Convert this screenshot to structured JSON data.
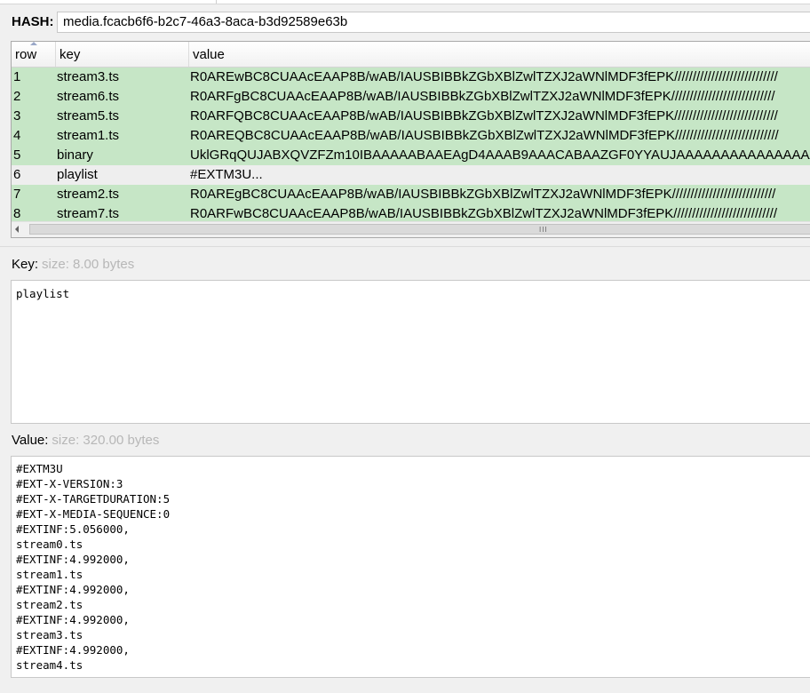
{
  "hash": {
    "label": "HASH:",
    "value": "media.fcacb6f6-b2c7-46a3-8aca-b3d92589e63b"
  },
  "table": {
    "columns": {
      "row": "row",
      "key": "key",
      "value": "value"
    },
    "rows": [
      {
        "row": "1",
        "key": "stream3.ts",
        "value": "R0AREwBC8CUAAcEAAP8B/wAB/IAUSBIBBkZGbXBlZwlTZXJ2aWNlMDF3fEPK////////////////////////////",
        "highlight": "green"
      },
      {
        "row": "2",
        "key": "stream6.ts",
        "value": "R0ARFgBC8CUAAcEAAP8B/wAB/IAUSBIBBkZGbXBlZwlTZXJ2aWNlMDF3fEPK////////////////////////////",
        "highlight": "green"
      },
      {
        "row": "3",
        "key": "stream5.ts",
        "value": "R0ARFQBC8CUAAcEAAP8B/wAB/IAUSBIBBkZGbXBlZwlTZXJ2aWNlMDF3fEPK////////////////////////////",
        "highlight": "green"
      },
      {
        "row": "4",
        "key": "stream1.ts",
        "value": "R0AREQBC8CUAAcEAAP8B/wAB/IAUSBIBBkZGbXBlZwlTZXJ2aWNlMDF3fEPK////////////////////////////",
        "highlight": "green"
      },
      {
        "row": "5",
        "key": "binary",
        "value": "UklGRqQUJABXQVZFZm10IBAAAAABAAEAgD4AAAB9AAACABAAZGF0YYAUJAAAAAAAAAAAAAAAA",
        "highlight": "green"
      },
      {
        "row": "6",
        "key": "playlist",
        "value": "#EXTM3U...",
        "highlight": "plain"
      },
      {
        "row": "7",
        "key": "stream2.ts",
        "value": "R0AREgBC8CUAAcEAAP8B/wAB/IAUSBIBBkZGbXBlZwlTZXJ2aWNlMDF3fEPK////////////////////////////",
        "highlight": "green"
      },
      {
        "row": "8",
        "key": "stream7.ts",
        "value": "R0ARFwBC8CUAAcEAAP8B/wAB/IAUSBIBBkZGbXBlZwlTZXJ2aWNlMDF3fEPK////////////////////////////",
        "highlight": "green"
      }
    ],
    "scroll_grip": "III"
  },
  "key_section": {
    "label": "Key:",
    "size": "size: 8.00 bytes",
    "content": "playlist"
  },
  "value_section": {
    "label": "Value:",
    "size": "size: 320.00 bytes",
    "lines": [
      "#EXTM3U",
      "#EXT-X-VERSION:3",
      "#EXT-X-TARGETDURATION:5",
      "#EXT-X-MEDIA-SEQUENCE:0",
      "#EXTINF:5.056000,",
      "stream0.ts",
      "#EXTINF:4.992000,",
      "stream1.ts",
      "#EXTINF:4.992000,",
      "stream2.ts",
      "#EXTINF:4.992000,",
      "stream3.ts",
      "#EXTINF:4.992000,",
      "stream4.ts"
    ]
  },
  "colors": {
    "row_highlight": "#c6e6c6",
    "row_plain": "#eeeeee",
    "size_hint": "#b7b7b7"
  }
}
